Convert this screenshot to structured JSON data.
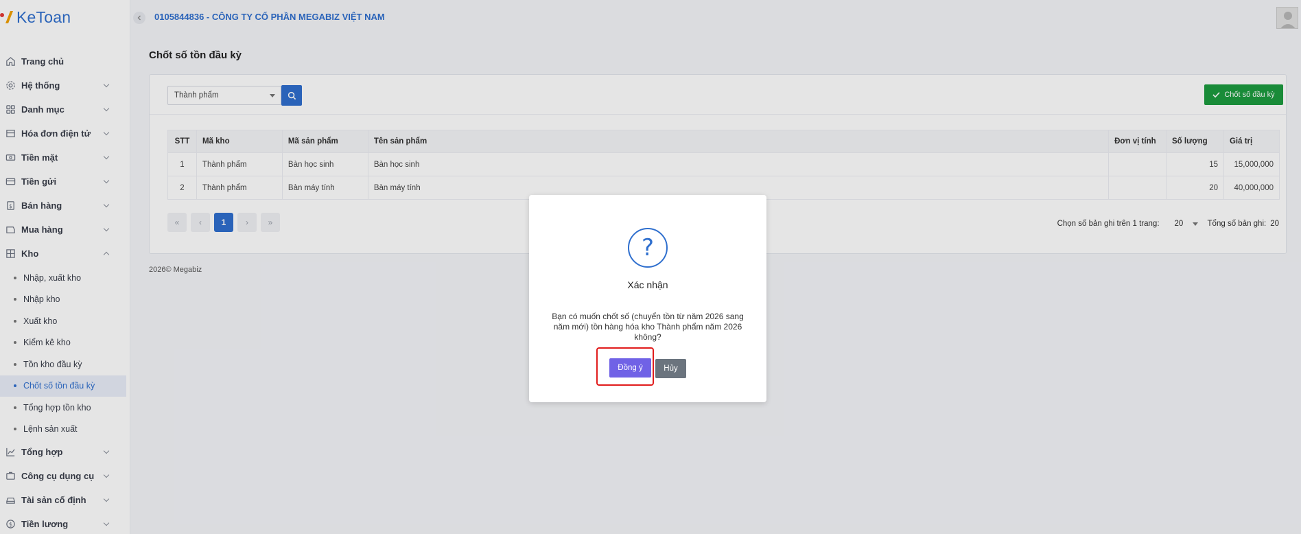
{
  "brand": {
    "name": "KeToan"
  },
  "header": {
    "company": "0105844836 - CÔNG TY CỔ PHẦN MEGABIZ VIỆT NAM"
  },
  "sidebar": {
    "items": [
      {
        "label": "Trang chủ",
        "icon": "home-icon"
      },
      {
        "label": "Hệ thống",
        "icon": "gear-icon"
      },
      {
        "label": "Danh mục",
        "icon": "grid-icon"
      },
      {
        "label": "Hóa đơn điện tử",
        "icon": "invoice-icon"
      },
      {
        "label": "Tiền mặt",
        "icon": "cash-icon"
      },
      {
        "label": "Tiền gửi",
        "icon": "bank-card-icon"
      },
      {
        "label": "Bán hàng",
        "icon": "sales-icon"
      },
      {
        "label": "Mua hàng",
        "icon": "purchase-icon"
      },
      {
        "label": "Kho",
        "icon": "warehouse-icon"
      }
    ],
    "kho_sub": [
      {
        "label": "Nhập, xuất kho"
      },
      {
        "label": "Nhập kho"
      },
      {
        "label": "Xuất kho"
      },
      {
        "label": "Kiểm kê kho"
      },
      {
        "label": "Tồn kho đầu kỳ"
      },
      {
        "label": "Chốt số tồn đầu kỳ",
        "active": true
      },
      {
        "label": "Tổng hợp tồn kho"
      },
      {
        "label": "Lệnh sản xuất"
      }
    ],
    "bottom_items": [
      {
        "label": "Tổng hợp",
        "icon": "chart-line-icon"
      },
      {
        "label": "Công cụ dụng cụ",
        "icon": "tools-icon"
      },
      {
        "label": "Tài sản cố định",
        "icon": "car-icon"
      },
      {
        "label": "Tiền lương",
        "icon": "dollar-icon"
      }
    ]
  },
  "page": {
    "title": "Chốt số tồn đầu kỳ"
  },
  "toolbar": {
    "warehouse_select": "Thành phẩm",
    "close_button": "Chốt số đầu kỳ"
  },
  "table": {
    "headers": [
      "STT",
      "Mã kho",
      "Mã sản phẩm",
      "Tên sản phẩm",
      "Đơn vị tính",
      "Số lượng",
      "Giá trị"
    ],
    "rows": [
      [
        "1",
        "Thành phẩm",
        "Bàn học sinh",
        "Bàn học sinh",
        "",
        "15",
        "15,000,000"
      ],
      [
        "2",
        "Thành phẩm",
        "Bàn máy tính",
        "Bàn máy tính",
        "",
        "20",
        "40,000,000"
      ]
    ]
  },
  "pagination": {
    "current": "1",
    "per_page_label": "Chọn số bản ghi trên 1 trang:",
    "per_page_value": "20",
    "total_label": "Tổng số bản ghi:",
    "total_value": "20"
  },
  "footer": {
    "text": "2026© Megabiz"
  },
  "modal": {
    "title": "Xác nhận",
    "message": "Bạn có muốn chốt số (chuyển tồn từ năm 2026 sang năm mới) tồn hàng hóa kho Thành phẩm năm 2026 không?",
    "ok": "Đồng ý",
    "cancel": "Hủy"
  },
  "colors": {
    "primary": "#2f6fce",
    "success": "#1c9b3f",
    "confirm": "#7062e6",
    "highlight": "#e11c1c"
  }
}
